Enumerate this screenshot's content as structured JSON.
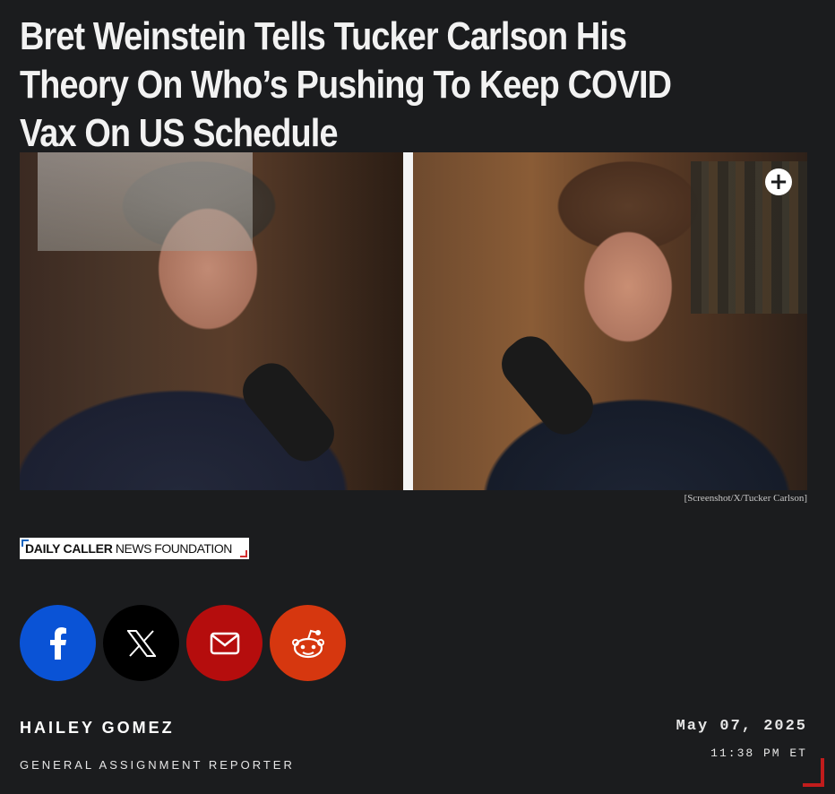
{
  "article": {
    "headline": "Bret Weinstein Tells Tucker Carlson His Theory On Who’s Pushing To Keep COVID Vax On US Schedule",
    "image_caption": "[Screenshot/X/Tucker Carlson]"
  },
  "source_logo": {
    "part1": "DAILY CALLER",
    "part2": " NEWS FOUNDATION"
  },
  "share": [
    {
      "name": "facebook",
      "icon": "facebook-icon",
      "color": "#0a53d6"
    },
    {
      "name": "x",
      "icon": "x-icon",
      "color": "#000000"
    },
    {
      "name": "email",
      "icon": "email-icon",
      "color": "#b50d0d"
    },
    {
      "name": "reddit",
      "icon": "reddit-icon",
      "color": "#d6370f"
    }
  ],
  "byline": {
    "author": "HAILEY GOMEZ",
    "role": "GENERAL ASSIGNMENT REPORTER",
    "date": "May 07, 2025",
    "time": "11:38 PM ET"
  },
  "colors": {
    "background": "#1b1c1e",
    "accent": "#c11c1c"
  }
}
